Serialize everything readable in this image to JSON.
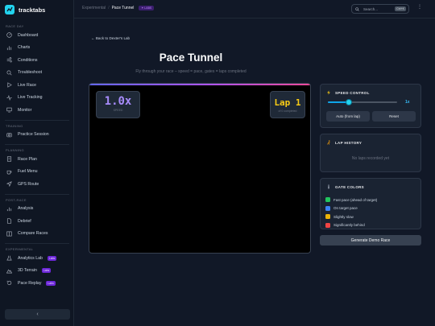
{
  "app": {
    "name": "tracktabs"
  },
  "sidebar": {
    "sections": [
      {
        "title": "RACE DAY",
        "items": [
          {
            "label": "Dashboard",
            "icon": "dashboard-icon"
          },
          {
            "label": "Charts",
            "icon": "bar-chart-icon"
          },
          {
            "label": "Conditions",
            "icon": "wind-icon"
          },
          {
            "label": "Troubleshoot",
            "icon": "search-icon"
          },
          {
            "label": "Live Race",
            "icon": "play-icon"
          },
          {
            "label": "Live Tracking",
            "icon": "activity-icon"
          },
          {
            "label": "Monitor",
            "icon": "monitor-icon"
          }
        ]
      },
      {
        "title": "TRAINING",
        "items": [
          {
            "label": "Practice Session",
            "icon": "camera-icon"
          }
        ]
      },
      {
        "title": "PLANNING",
        "items": [
          {
            "label": "Race Plan",
            "icon": "document-icon"
          },
          {
            "label": "Fuel Menu",
            "icon": "cup-icon"
          },
          {
            "label": "GPS Route",
            "icon": "navigation-icon"
          }
        ]
      },
      {
        "title": "POST-RACE",
        "items": [
          {
            "label": "Analysis",
            "icon": "bar-chart-icon"
          },
          {
            "label": "Debrief",
            "icon": "file-icon"
          },
          {
            "label": "Compare Races",
            "icon": "columns-icon"
          }
        ]
      },
      {
        "title": "EXPERIMENTAL",
        "items": [
          {
            "label": "Analytics Lab",
            "icon": "flask-icon",
            "badge": "Labs"
          },
          {
            "label": "3D Terrain",
            "icon": "mountain-icon",
            "badge": "Labs"
          },
          {
            "label": "Pace Replay",
            "icon": "replay-icon",
            "badge": "Labs"
          }
        ]
      }
    ],
    "collapse_label": "‹"
  },
  "topbar": {
    "breadcrumb_parent": "Experimental",
    "breadcrumb_sep": "/",
    "breadcrumb_current": "Pace Tunnel",
    "badge": "✦ LABS",
    "search_placeholder": "Search...",
    "search_shortcut": "Ctrl+K",
    "more": "⋮"
  },
  "page": {
    "back_link": "← Back to Dexter's Lab",
    "title": "Pace Tunnel",
    "subtitle": "Fly through your race – speed = pace, gates = laps completed"
  },
  "tunnel": {
    "speed_value": "1.0x",
    "speed_label": "SPEED",
    "lap_value": "Lap 1",
    "lap_label": "of 0 completed"
  },
  "speed_control": {
    "title": "SPEED CONTROL",
    "value_label": "1x",
    "slider_fraction": 0.3,
    "auto_button": "Auto (from lap)",
    "reset_button": "Reset"
  },
  "lap_history": {
    "title": "LAP HISTORY",
    "empty_text": "No laps recorded yet"
  },
  "gate_colors": {
    "title": "GATE COLORS",
    "items": [
      {
        "label": "Fast pace (ahead of target)",
        "color": "#22c55e"
      },
      {
        "label": "On target pace",
        "color": "#3b82f6"
      },
      {
        "label": "Slightly slow",
        "color": "#eab308"
      },
      {
        "label": "Significantly behind",
        "color": "#ef4444"
      }
    ]
  },
  "generate_button": "Generate Demo Race"
}
